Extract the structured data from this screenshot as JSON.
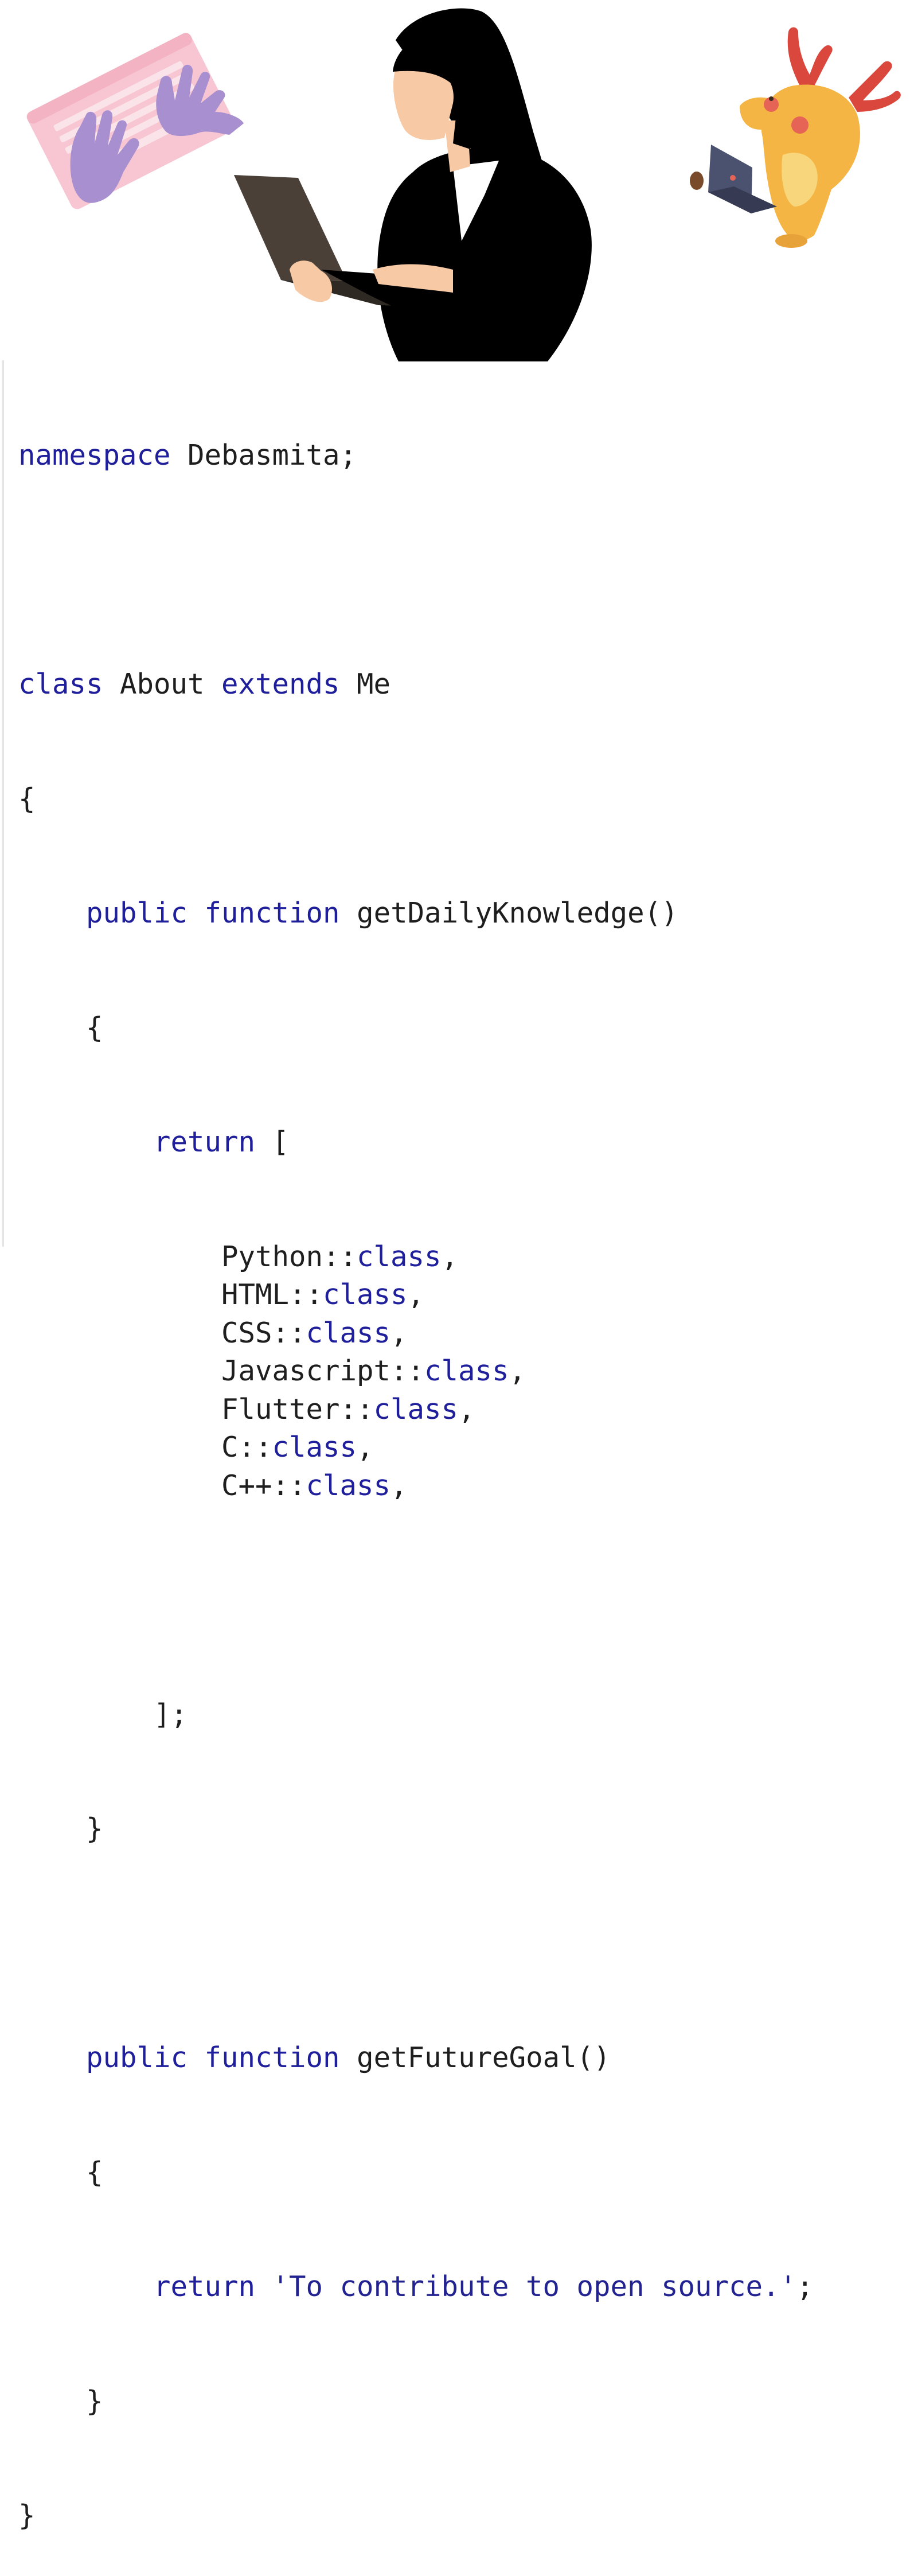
{
  "illustrations": {
    "hands_on_keyboard": "hands-on-keyboard-illustration",
    "woman_with_laptop": "woman-with-laptop-illustration",
    "mascot_with_laptop": "deer-mascot-with-laptop-illustration"
  },
  "colors": {
    "keyword": "#1f1f9c",
    "text": "#1e1e1e",
    "keyboard_pink": "#f7c6d2",
    "glove_purple": "#a78fd0",
    "mascot_yellow": "#f4b544",
    "antler_red": "#d9473d"
  },
  "code": {
    "namespace_kw": "namespace",
    "namespace_rest": " Debasmita;",
    "class_kw": "class",
    "class_name": " About ",
    "extends_kw": "extends",
    "parent_name": " Me",
    "brace_open": "{",
    "brace_close": "}",
    "public_kw": "public",
    "function_kw": "function",
    "method1_name": " getDailyKnowledge()",
    "return_kw": "return",
    "array_open": " [",
    "items": [
      {
        "name": "Python::",
        "kw": "class",
        "tail": ","
      },
      {
        "name": "HTML::",
        "kw": "class",
        "tail": ","
      },
      {
        "name": "CSS::",
        "kw": "class",
        "tail": ","
      },
      {
        "name": "Javascript::",
        "kw": "class",
        "tail": ","
      },
      {
        "name": "Flutter::",
        "kw": "class",
        "tail": ","
      },
      {
        "name": "C::",
        "kw": "class",
        "tail": ","
      },
      {
        "name": "C++::",
        "kw": "class",
        "tail": ","
      }
    ],
    "array_close": "];",
    "method2_name": " getFutureGoal()",
    "goal_string": " 'To contribute to open source.'",
    "semicolon": ";"
  }
}
